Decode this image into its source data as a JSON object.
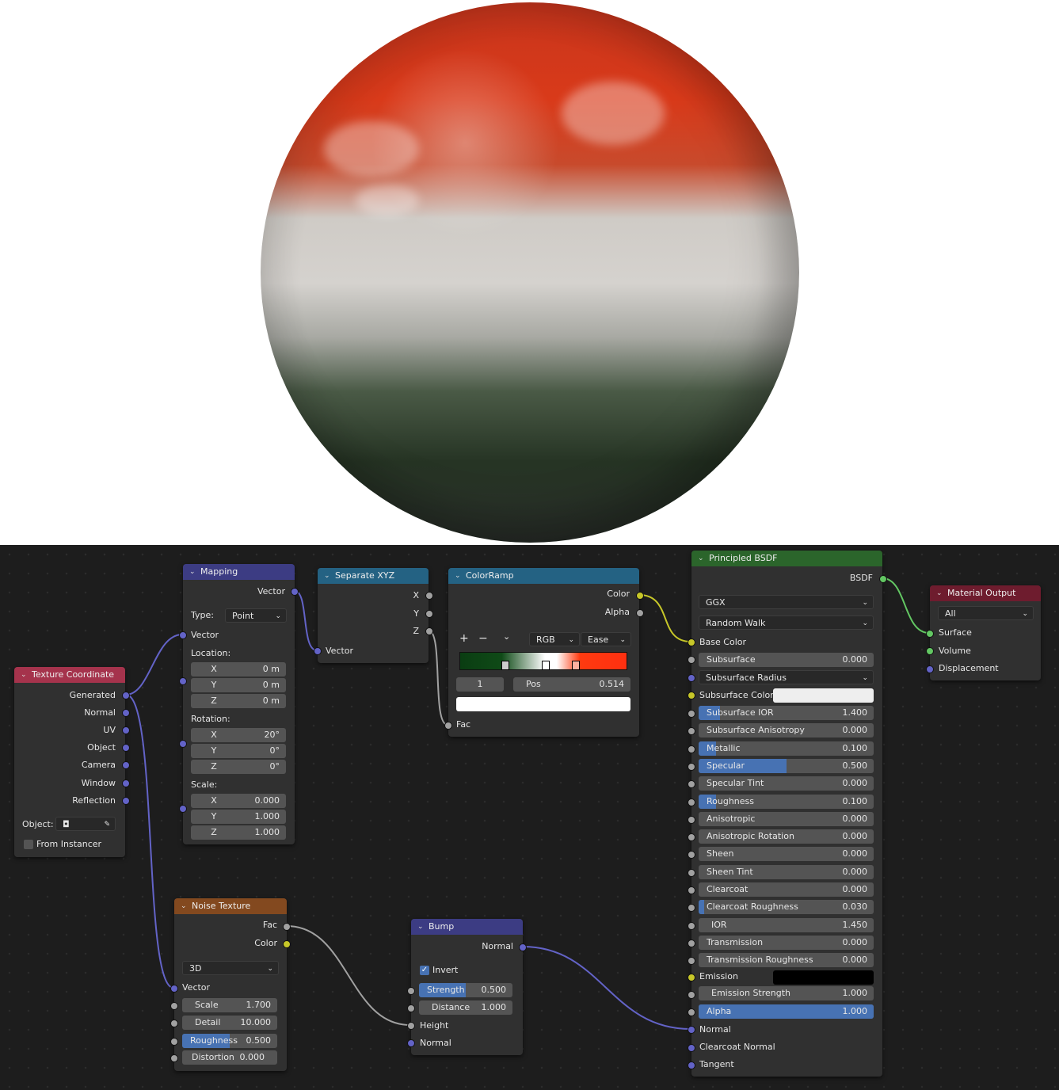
{
  "colors": {
    "texcoord": "#a5334c",
    "mapping": "#3c3c83",
    "separate": "#246283",
    "colorramp": "#246283",
    "noise": "#83491f",
    "bump": "#3c3c83",
    "bsdf": "#2b652b",
    "output": "#6e1c2e",
    "accent": "#4772b3"
  },
  "texcoord": {
    "title": "Texture Coordinate",
    "outputs": [
      "Generated",
      "Normal",
      "UV",
      "Object",
      "Camera",
      "Window",
      "Reflection"
    ],
    "object_label": "Object:",
    "from_instancer": "From Instancer"
  },
  "mapping": {
    "title": "Mapping",
    "out": "Vector",
    "type_label": "Type:",
    "type_value": "Point",
    "in_vector": "Vector",
    "location_label": "Location:",
    "location": [
      {
        "axis": "X",
        "value": "0 m"
      },
      {
        "axis": "Y",
        "value": "0 m"
      },
      {
        "axis": "Z",
        "value": "0 m"
      }
    ],
    "rotation_label": "Rotation:",
    "rotation": [
      {
        "axis": "X",
        "value": "20°"
      },
      {
        "axis": "Y",
        "value": "0°"
      },
      {
        "axis": "Z",
        "value": "0°"
      }
    ],
    "scale_label": "Scale:",
    "scale": [
      {
        "axis": "X",
        "value": "0.000"
      },
      {
        "axis": "Y",
        "value": "1.000"
      },
      {
        "axis": "Z",
        "value": "1.000"
      }
    ]
  },
  "separate": {
    "title": "Separate XYZ",
    "outputs": [
      "X",
      "Y",
      "Z"
    ],
    "in": "Vector"
  },
  "colorramp": {
    "title": "ColorRamp",
    "out_color": "Color",
    "out_alpha": "Alpha",
    "plus": "+",
    "minus": "−",
    "menu": "⌄",
    "mode": "RGB",
    "interp": "Ease",
    "index": "1",
    "pos_label": "Pos",
    "pos_value": "0.514",
    "in": "Fac"
  },
  "noise": {
    "title": "Noise Texture",
    "out_fac": "Fac",
    "out_color": "Color",
    "dim": "3D",
    "in_vector": "Vector",
    "fields": [
      {
        "label": "Scale",
        "value": "1.700",
        "fill": 0
      },
      {
        "label": "Detail",
        "value": "10.000",
        "fill": 0
      },
      {
        "label": "Roughness",
        "value": "0.500",
        "fill": 0.5
      },
      {
        "label": "Distortion",
        "value": "0.000",
        "fill": 0
      }
    ]
  },
  "bump": {
    "title": "Bump",
    "out": "Normal",
    "invert": "Invert",
    "fields": [
      {
        "label": "Strength",
        "value": "0.500",
        "fill": 0.5
      },
      {
        "label": "Distance",
        "value": "1.000",
        "fill": 0
      }
    ],
    "in_height": "Height",
    "in_normal": "Normal"
  },
  "bsdf": {
    "title": "Principled BSDF",
    "out": "BSDF",
    "distribution": "GGX",
    "subsurface_method": "Random Walk",
    "base_color": "Base Color",
    "subsurface": {
      "label": "Subsurface",
      "value": "0.000",
      "fill": 0
    },
    "subsurface_radius": "Subsurface Radius",
    "subsurface_color": "Subsurface Color",
    "fields": [
      {
        "label": "Subsurface IOR",
        "value": "1.400",
        "fill": 0.12
      },
      {
        "label": "Subsurface Anisotropy",
        "value": "0.000",
        "fill": 0
      },
      {
        "label": "Metallic",
        "value": "0.100",
        "fill": 0.1
      },
      {
        "label": "Specular",
        "value": "0.500",
        "fill": 0.5
      },
      {
        "label": "Specular Tint",
        "value": "0.000",
        "fill": 0
      },
      {
        "label": "Roughness",
        "value": "0.100",
        "fill": 0.1
      },
      {
        "label": "Anisotropic",
        "value": "0.000",
        "fill": 0
      },
      {
        "label": "Anisotropic Rotation",
        "value": "0.000",
        "fill": 0
      },
      {
        "label": "Sheen",
        "value": "0.000",
        "fill": 0
      },
      {
        "label": "Sheen Tint",
        "value": "0.000",
        "fill": 0
      },
      {
        "label": "Clearcoat",
        "value": "0.000",
        "fill": 0
      },
      {
        "label": "Clearcoat Roughness",
        "value": "0.030",
        "fill": 0.03
      },
      {
        "label": "IOR",
        "value": "1.450",
        "fill": 0
      },
      {
        "label": "Transmission",
        "value": "0.000",
        "fill": 0
      },
      {
        "label": "Transmission Roughness",
        "value": "0.000",
        "fill": 0
      }
    ],
    "emission": "Emission",
    "emission_strength": {
      "label": "Emission Strength",
      "value": "1.000",
      "fill": 0
    },
    "alpha": {
      "label": "Alpha",
      "value": "1.000",
      "fill": 1
    },
    "normal": "Normal",
    "clearcoat_normal": "Clearcoat Normal",
    "tangent": "Tangent"
  },
  "output": {
    "title": "Material Output",
    "target": "All",
    "inputs": [
      "Surface",
      "Volume",
      "Displacement"
    ]
  }
}
